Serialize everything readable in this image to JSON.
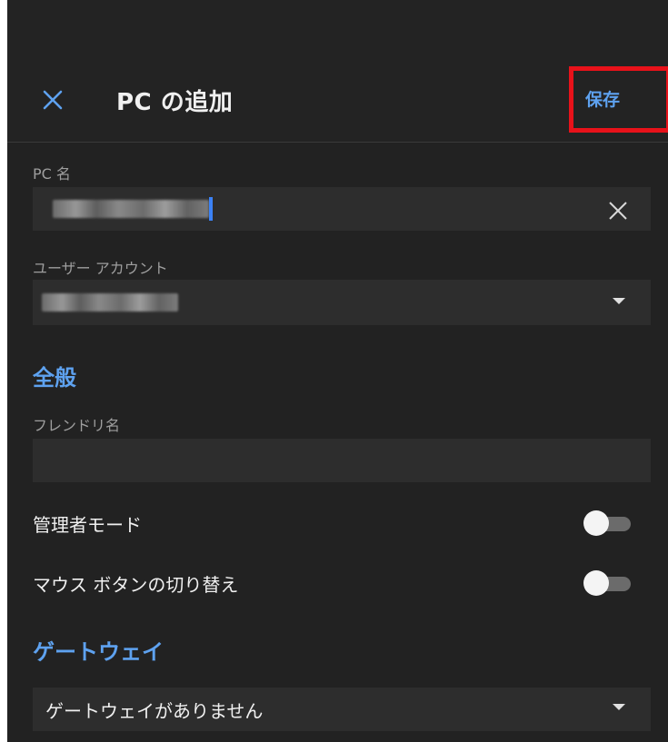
{
  "header": {
    "title": "PC の追加",
    "save_label": "保存"
  },
  "form": {
    "pc_name": {
      "label": "PC 名",
      "value": "[blurred]"
    },
    "user_account": {
      "label": "ユーザー アカウント",
      "value": "[blurred]"
    }
  },
  "general": {
    "heading": "全般",
    "friendly_name": {
      "label": "フレンドリ名",
      "value": ""
    },
    "admin_mode": {
      "label": "管理者モード",
      "on": false
    },
    "swap_mouse_buttons": {
      "label": "マウス ボタンの切り替え",
      "on": false
    }
  },
  "gateway": {
    "heading": "ゲートウェイ",
    "selected": "ゲートウェイがありません"
  },
  "colors": {
    "accent": "#5ea2f0",
    "background": "#222222",
    "highlight_box": "#e8121a"
  }
}
